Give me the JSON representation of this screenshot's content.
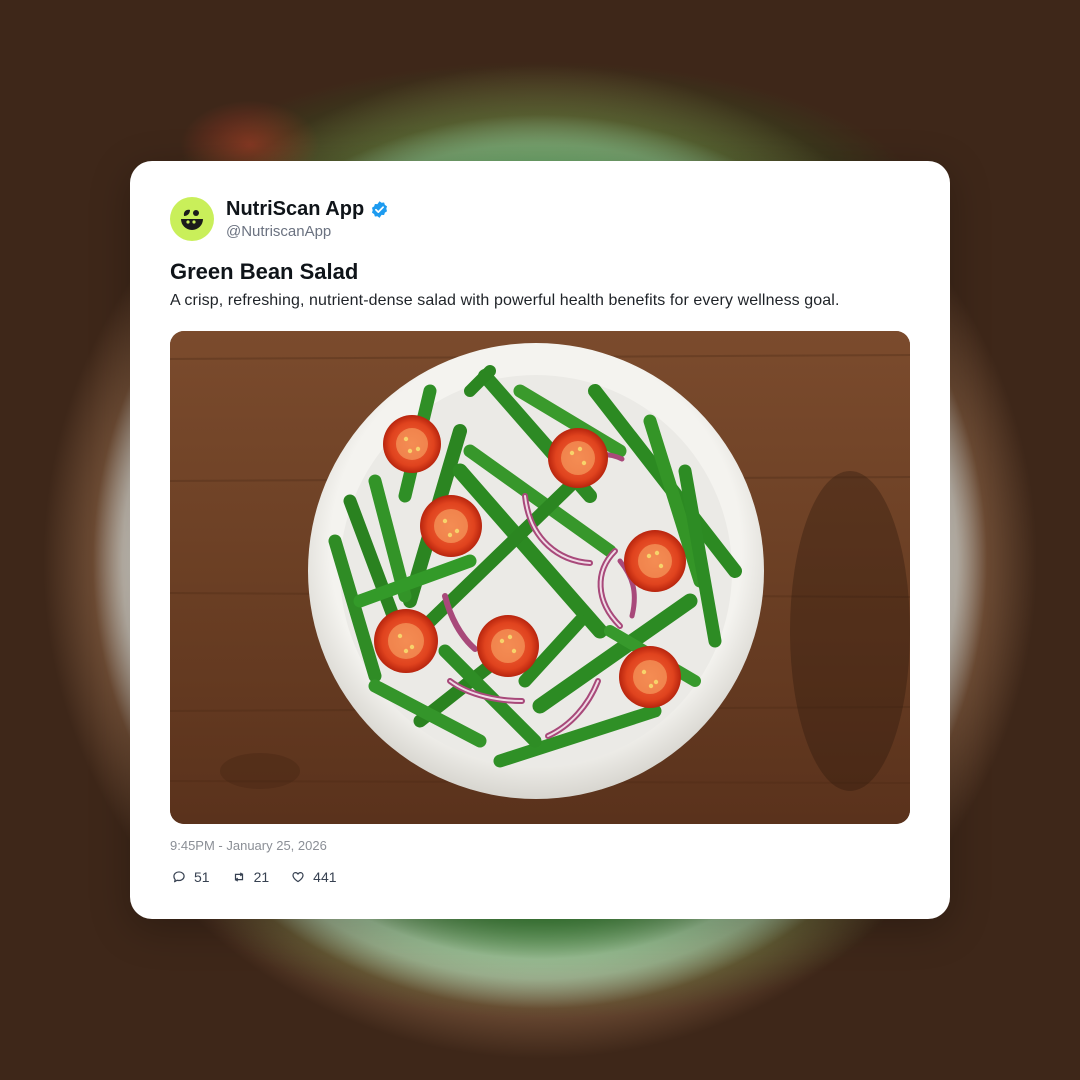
{
  "post": {
    "account": {
      "display_name": "NutriScan App",
      "handle": "@NutriscanApp",
      "verified": true,
      "avatar_color": "#c9ef5a"
    },
    "title": "Green Bean Salad",
    "description": "A crisp, refreshing, nutrient-dense salad with powerful health benefits for every wellness goal.",
    "image_icon": "green-bean-salad-photo",
    "timestamp": "9:45PM - January 25, 2026",
    "stats": {
      "replies": "51",
      "reposts": "21",
      "likes": "441"
    }
  },
  "icons": {
    "reply": "comment-icon",
    "repost": "repost-icon",
    "like": "heart-icon",
    "verified": "verified-badge-icon"
  },
  "colors": {
    "verified_blue": "#1d9bf0",
    "card_background": "#ffffff"
  }
}
